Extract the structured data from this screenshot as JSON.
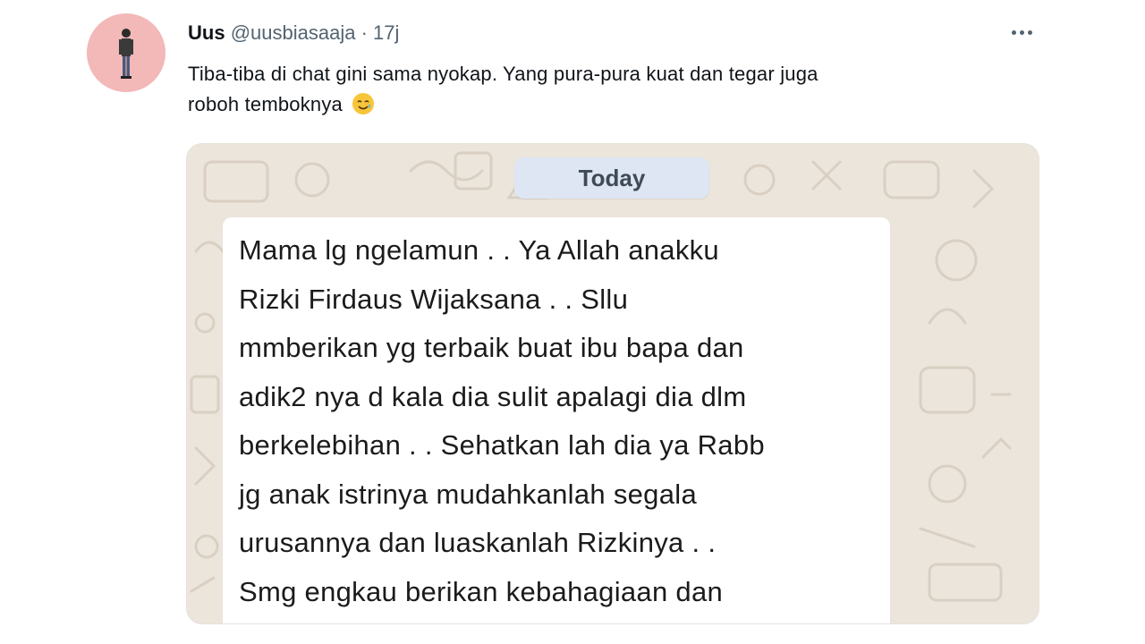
{
  "tweet": {
    "name": "Uus",
    "handle": "@uusbiasaaja",
    "separator": "·",
    "time": "17j",
    "text_line_1": "Tiba-tiba di chat gini sama nyokap. Yang pura-pura kuat dan tegar juga",
    "text_line_2": "roboh temboknya",
    "emoji_icon": "smiling-face-with-tear-icon"
  },
  "chat": {
    "day_label": "Today",
    "message_lines": [
      "Mama lg ngelamun . . Ya Allah anakku",
      "Rizki Firdaus Wijaksana . . Sllu",
      "mmberikan yg terbaik buat ibu bapa dan",
      "adik2 nya d kala dia sulit apalagi dia dlm",
      "berkelebihan . . Sehatkan lah dia ya Rabb",
      "jg anak istrinya mudahkanlah segala",
      "urusannya dan luaskanlah Rizkinya . .",
      "Smg engkau berikan kebahagiaan dan"
    ]
  },
  "colors": {
    "avatar_bg": "#f3b8b8",
    "chat_wallpaper": "#ece5dc",
    "day_chip_bg": "#dde6f2",
    "bubble_bg": "#ffffff"
  }
}
